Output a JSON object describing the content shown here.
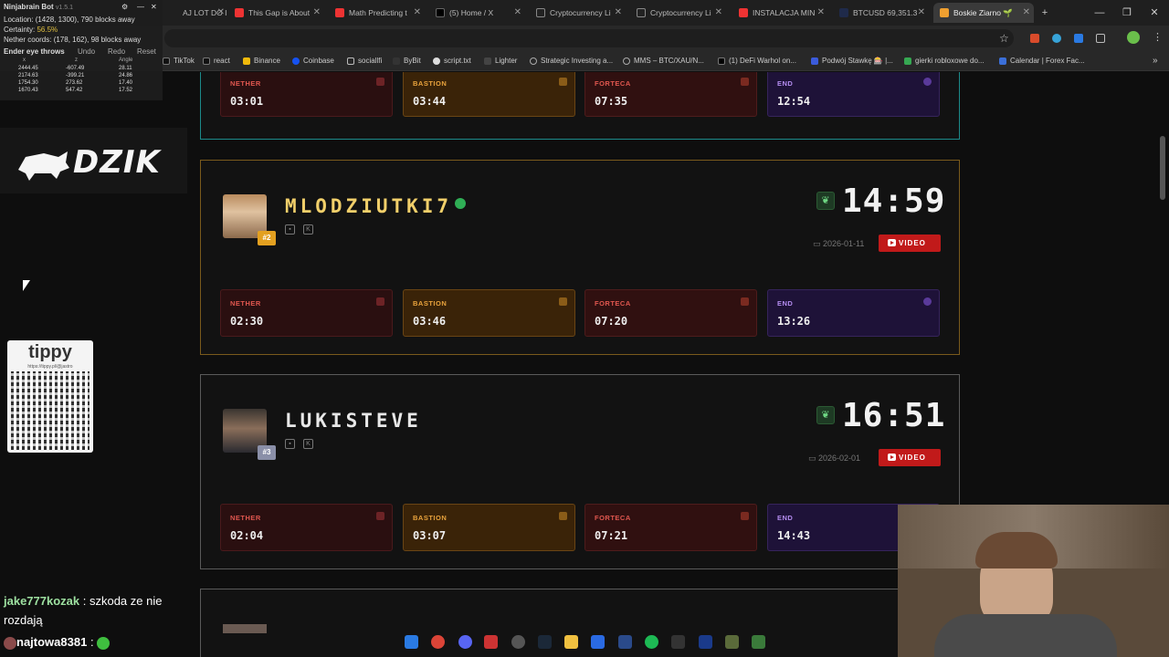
{
  "browser": {
    "tabs": [
      {
        "label": "AJ LOT DO I",
        "active": false
      },
      {
        "label": "This Gap is About",
        "active": false
      },
      {
        "label": "Math Predicting t",
        "active": false
      },
      {
        "label": "(5) Home / X",
        "active": false
      },
      {
        "label": "Cryptocurrency Li",
        "active": false
      },
      {
        "label": "Cryptocurrency Li",
        "active": false
      },
      {
        "label": "INSTALACJA MIN",
        "active": false
      },
      {
        "label": "BTCUSD 69,351.3",
        "active": false
      },
      {
        "label": "Boskie Ziarno 🌱",
        "active": true
      }
    ],
    "bookmarks": [
      "TikTok",
      "react",
      "Binance",
      "Coinbase",
      "sociallfi",
      "ByBit",
      "script.txt",
      "Lighter",
      "Strategic Investing a...",
      "MMS – BTC/XAU/N...",
      "(1) DeFi Warhol on...",
      "Podwój Stawkę 🎰 |...",
      "gierki robloxowe do...",
      "Calendar | Forex Fac..."
    ]
  },
  "ninjabrain": {
    "title": "Ninjabrain Bot",
    "version": "v1.5.1",
    "location": "Location: (1428, 1300), 790 blocks away",
    "certainty_label": "Certainty:",
    "certainty_value": "56.5%",
    "nether": "Nether coords: (178, 162), 98 blocks away",
    "ender_label": "Ender eye throws",
    "undo": "Undo",
    "redo": "Redo",
    "reset": "Reset",
    "col_x": "x",
    "col_z": "z",
    "col_angle": "Angle",
    "rows": [
      [
        "2444.45",
        "-607.49",
        "28.11"
      ],
      [
        "2174.63",
        "-399.21",
        "24.86"
      ],
      [
        "1754.30",
        "273.62",
        "17.40"
      ],
      [
        "1670.43",
        "547.42",
        "17.52"
      ]
    ]
  },
  "overlay": {
    "dzik": "DZIK",
    "tippy_title": "tippy",
    "tippy_url": "https://tippy.pl/@jastro"
  },
  "runs": [
    {
      "name": "",
      "final_time": "",
      "splits": {
        "nether": "03:01",
        "bastion": "03:44",
        "forteca": "07:35",
        "end": "12:54"
      }
    },
    {
      "name": "MLODZIUTKI7",
      "rank": "#2",
      "final_time": "14:59",
      "date": "2026-01-11",
      "video": "VIDEO",
      "splits": {
        "nether": "02:30",
        "bastion": "03:46",
        "forteca": "07:20",
        "end": "13:26"
      }
    },
    {
      "name": "LUKISTEVE",
      "rank": "#3",
      "final_time": "16:51",
      "date": "2026-02-01",
      "video": "VIDEO",
      "splits": {
        "nether": "02:04",
        "bastion": "03:07",
        "forteca": "07:21",
        "end": "14:43"
      }
    }
  ],
  "split_labels": {
    "nether": "NETHER",
    "bastion": "BASTION",
    "forteca": "FORTECA",
    "end": "END"
  },
  "chat": [
    {
      "user": "jake777kozak",
      "text": ": szkoda ze nie rozdają"
    },
    {
      "user": "najtowa8381",
      "text": ":"
    }
  ]
}
